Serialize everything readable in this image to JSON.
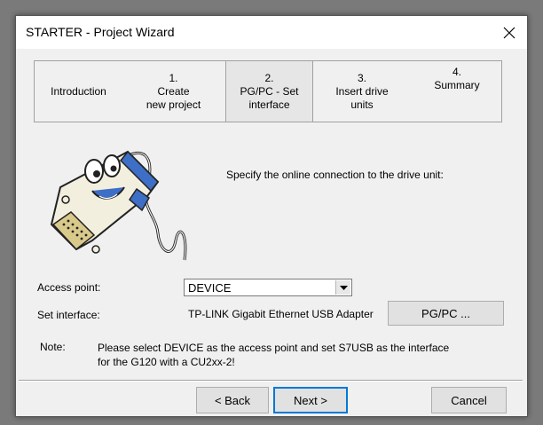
{
  "window": {
    "title": "STARTER - Project Wizard"
  },
  "steps": [
    {
      "lines": [
        "Introduction"
      ],
      "active": false
    },
    {
      "lines": [
        "1.",
        "Create",
        "new project"
      ],
      "active": false
    },
    {
      "lines": [
        "2.",
        "PG/PC - Set",
        "interface"
      ],
      "active": true
    },
    {
      "lines": [
        "3.",
        "Insert drive",
        "units"
      ],
      "active": false
    },
    {
      "lines": [
        "4.",
        "Summary"
      ],
      "active": false
    }
  ],
  "main": {
    "instruction": "Specify the online connection to the drive unit:",
    "access_point_label": "Access point:",
    "access_point_value": "DEVICE",
    "set_interface_label": "Set interface:",
    "interface_value": "TP-LINK Gigabit Ethernet USB Adapter",
    "pgpc_button": "PG/PC ...",
    "note_label": "Note:",
    "note_text": "Please select DEVICE as the access point and set S7USB as the interface for the G120 with a CU2xx-2!"
  },
  "footer": {
    "back_button": "< Back",
    "next_button": "Next >",
    "cancel_button": "Cancel"
  },
  "icons": {
    "close": "close-icon",
    "dropdown": "chevron-down-icon",
    "mascot": "cable-mascot-icon"
  }
}
